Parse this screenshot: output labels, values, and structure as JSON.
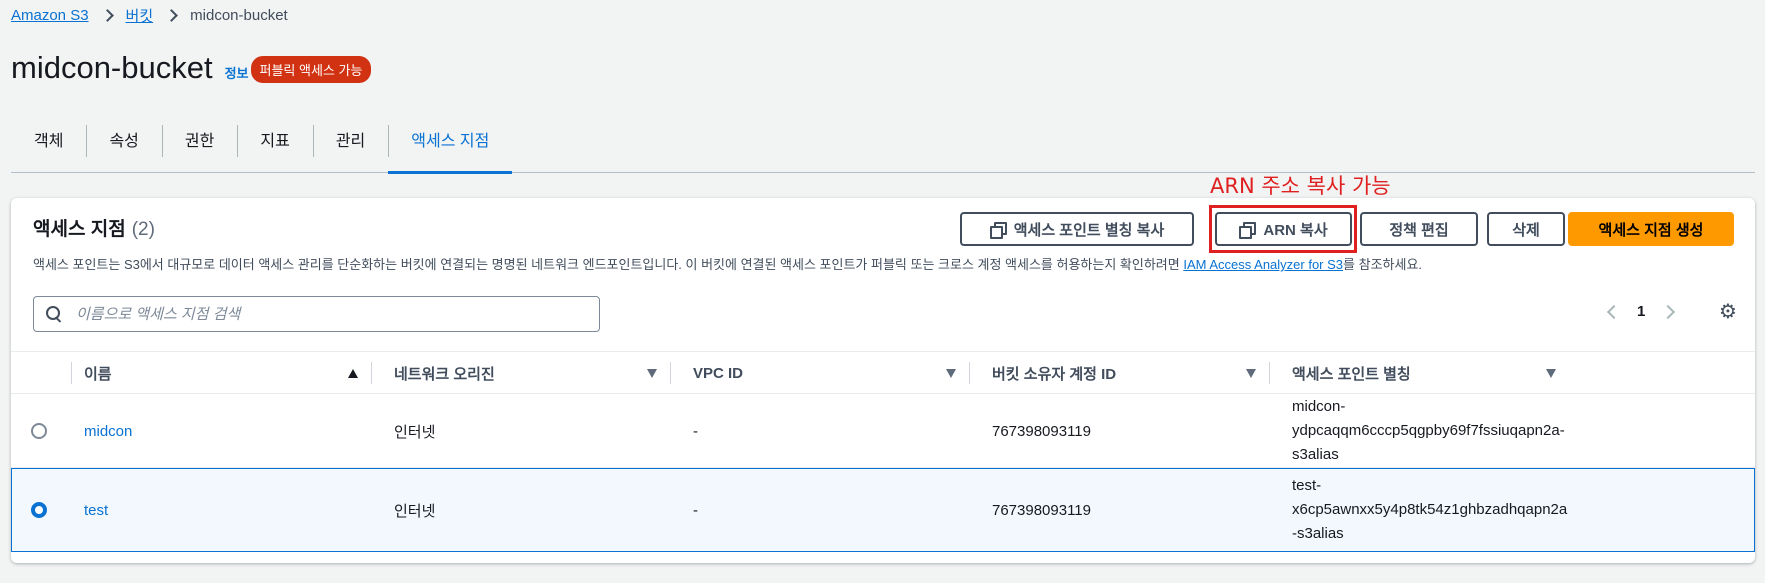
{
  "breadcrumb": {
    "root": "Amazon S3",
    "buckets": "버킷",
    "current": "midcon-bucket"
  },
  "header": {
    "title": "midcon-bucket",
    "info": "정보",
    "badge": "퍼블릭 액세스 가능"
  },
  "tabs": [
    "객체",
    "속성",
    "권한",
    "지표",
    "관리",
    "액세스 지점"
  ],
  "annotation": "ARN 주소 복사 가능",
  "panel": {
    "title": "액세스 지점",
    "count": "(2)",
    "description": "액세스 포인트는 S3에서 대규모로 데이터 액세스 관리를 단순화하는 버킷에 연결되는 명명된 네트워크 엔드포인트입니다. 이 버킷에 연결된 액세스 포인트가 퍼블릭 또는 크로스 계정 액세스를 허용하는지 확인하려면 ",
    "description_link": "IAM Access Analyzer for S3",
    "description_end": "를 참조하세요.",
    "buttons": {
      "copy_alias": "액세스 포인트 별칭 복사",
      "copy_arn": "ARN 복사",
      "edit_policy": "정책 편집",
      "delete": "삭제",
      "create": "액세스 지점 생성"
    },
    "search_placeholder": "이름으로 액세스 지점 검색",
    "page": "1"
  },
  "table": {
    "columns": [
      "이름",
      "네트워크 오리진",
      "VPC ID",
      "버킷 소유자 계정 ID",
      "액세스 포인트 별칭"
    ],
    "rows": [
      {
        "name": "midcon",
        "origin": "인터넷",
        "vpc": "-",
        "account": "767398093119",
        "alias_lines": [
          "midcon-",
          "ydpcaqqm6cccp5qgpby69f7fssiuqapn2a-",
          "s3alias"
        ],
        "selected": false
      },
      {
        "name": "test",
        "origin": "인터넷",
        "vpc": "-",
        "account": "767398093119",
        "alias_lines": [
          "test-",
          "x6cp5awnxx5y4p8tk54z1ghbzadhqapn2a",
          "-s3alias"
        ],
        "selected": true
      }
    ]
  },
  "colors": {
    "accent": "#0972d3",
    "badge": "#d13212",
    "primary_button": "#ff9900",
    "annotation": "#e02020"
  }
}
